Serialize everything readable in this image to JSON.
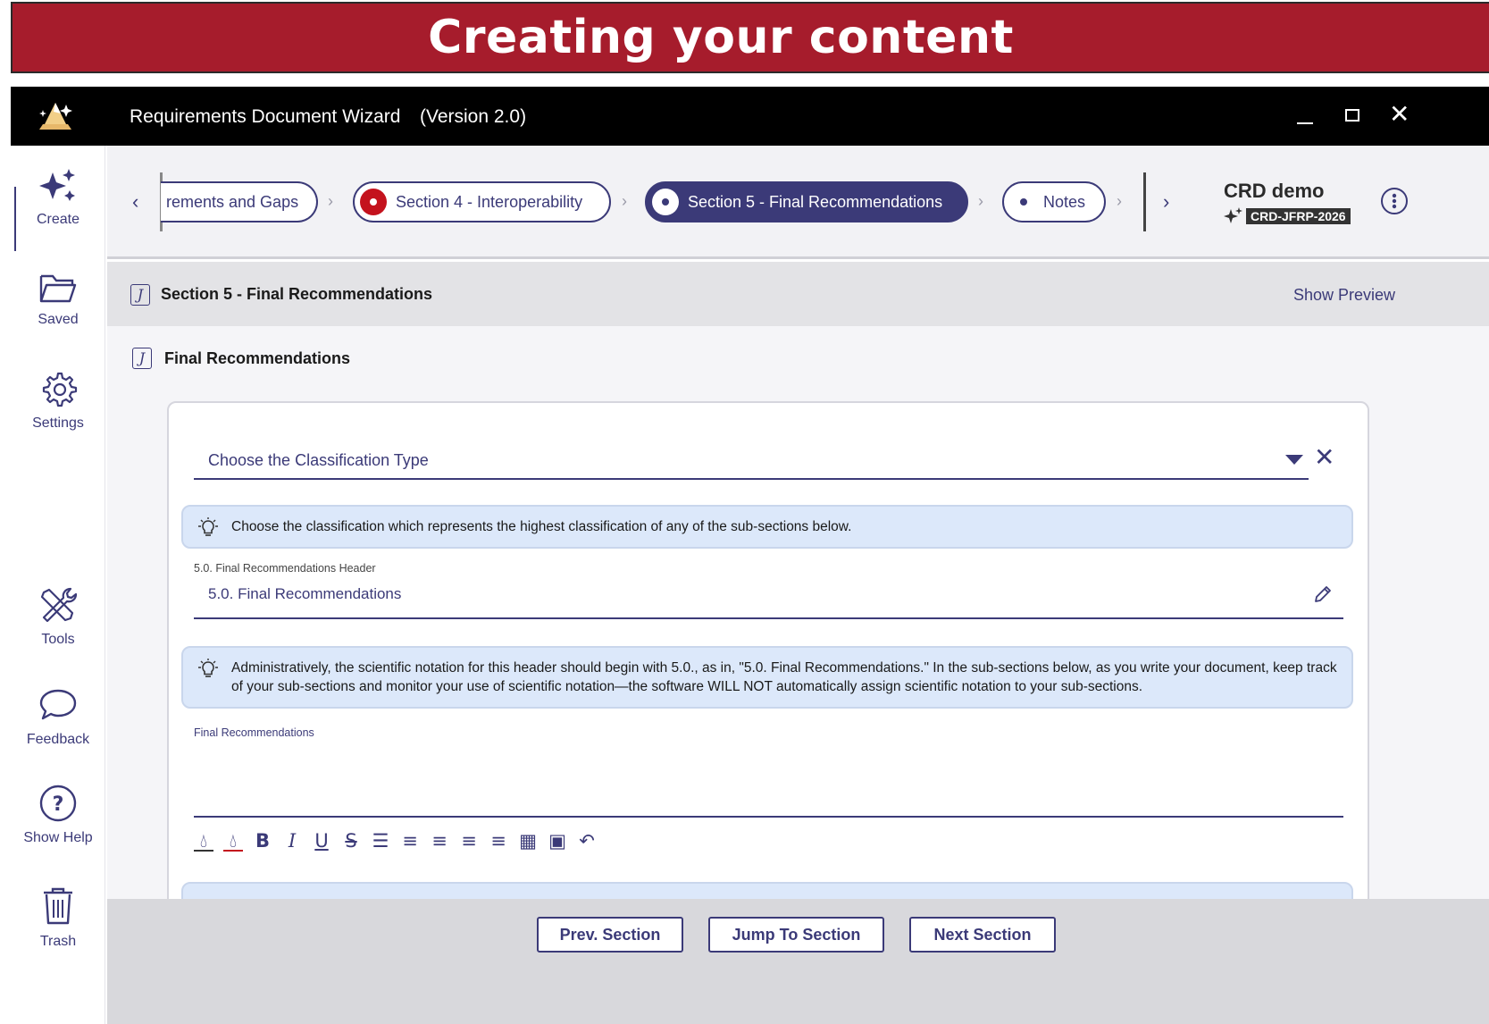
{
  "banner": {
    "title": "Creating your content"
  },
  "window": {
    "title": "Requirements Document Wizard",
    "version": "(Version 2.0)"
  },
  "sidebar": {
    "items": [
      {
        "label": "Create",
        "icon": "sparkle-icon",
        "active": true
      },
      {
        "label": "Saved",
        "icon": "folder-icon"
      },
      {
        "label": "Settings",
        "icon": "gear-icon"
      },
      {
        "label": "Tools",
        "icon": "tools-icon"
      },
      {
        "label": "Feedback",
        "icon": "chat-bubble-icon"
      },
      {
        "label": "Show Help",
        "icon": "help-icon"
      },
      {
        "label": "Trash",
        "icon": "trash-icon"
      }
    ]
  },
  "stepper": {
    "steps": [
      {
        "label": "rements and Gaps",
        "state": "partial"
      },
      {
        "label": "Section 4 - Interoperability",
        "state": "error"
      },
      {
        "label": "Section 5 - Final Recommendations",
        "state": "active"
      },
      {
        "label": "Notes",
        "state": "pending"
      }
    ]
  },
  "project": {
    "name": "CRD demo",
    "id": "CRD-JFRP-2026"
  },
  "section": {
    "title": "Section 5 - Final Recommendations",
    "show_preview": "Show Preview",
    "subsection_title": "Final Recommendations"
  },
  "form": {
    "classification_placeholder": "Choose the Classification Type",
    "classification_hint": "Choose the classification which represents the highest classification of any of the sub-sections below.",
    "header_label": "5.0. Final Recommendations Header",
    "header_value": "5.0. Final Recommendations",
    "header_hint": "Administratively, the scientific notation for this header should begin with 5.0., as in, \"5.0. Final Recommendations.\"  In the sub-sections below, as you write your document, keep track of your sub-sections and monitor your use of scientific notation—the software WILL NOT automatically assign scientific notation to your sub-sections.",
    "body_label": "Final Recommendations",
    "toolbar": [
      "text-color-icon",
      "highlight-color-icon",
      "bold-icon",
      "italic-icon",
      "underline-icon",
      "strikethrough-icon",
      "bullet-list-icon",
      "numbered-list-icon",
      "align-left-icon",
      "align-center-icon",
      "align-right-icon",
      "table-icon",
      "image-icon",
      "undo-icon"
    ]
  },
  "nav": {
    "prev": "Prev. Section",
    "jump": "Jump To Section",
    "next": "Next Section"
  },
  "colors": {
    "banner": "#a61c2c",
    "accent": "#3b3a78",
    "hint_bg": "#dce8fa",
    "error": "#c4121d"
  }
}
